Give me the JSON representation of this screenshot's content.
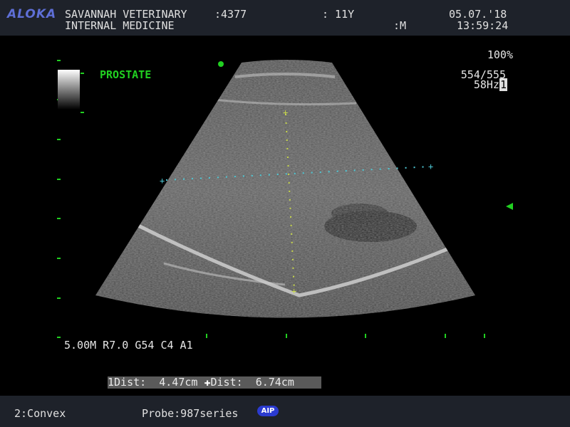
{
  "header": {
    "logo": "ALOKA",
    "clinic": "SAVANNAH VETERINARY",
    "id": ":4377",
    "age": ": 11Y",
    "date": "05.07.'18",
    "department": "INTERNAL MEDICINE",
    "sex": ":M",
    "time": "13:59:24"
  },
  "image": {
    "organ_label": "PROSTATE",
    "zoom": "100%",
    "frame_count": "554/555",
    "frame_rate": "58Hz",
    "frame_rate_box": "1",
    "params": "5.00M R7.0 G54 C4 A1",
    "marker_color": "#21d021",
    "cross_color": "#4ec9d6",
    "caliper_color": "#c8d84a"
  },
  "measurements": {
    "dist1_label": "1Dist:",
    "dist1_value": "4.47cm",
    "dist2_label": "Dist:",
    "dist2_value": "6.74cm"
  },
  "footer": {
    "probe_mode": "2:Convex",
    "probe": "Probe:987series",
    "badge": "AIP"
  }
}
